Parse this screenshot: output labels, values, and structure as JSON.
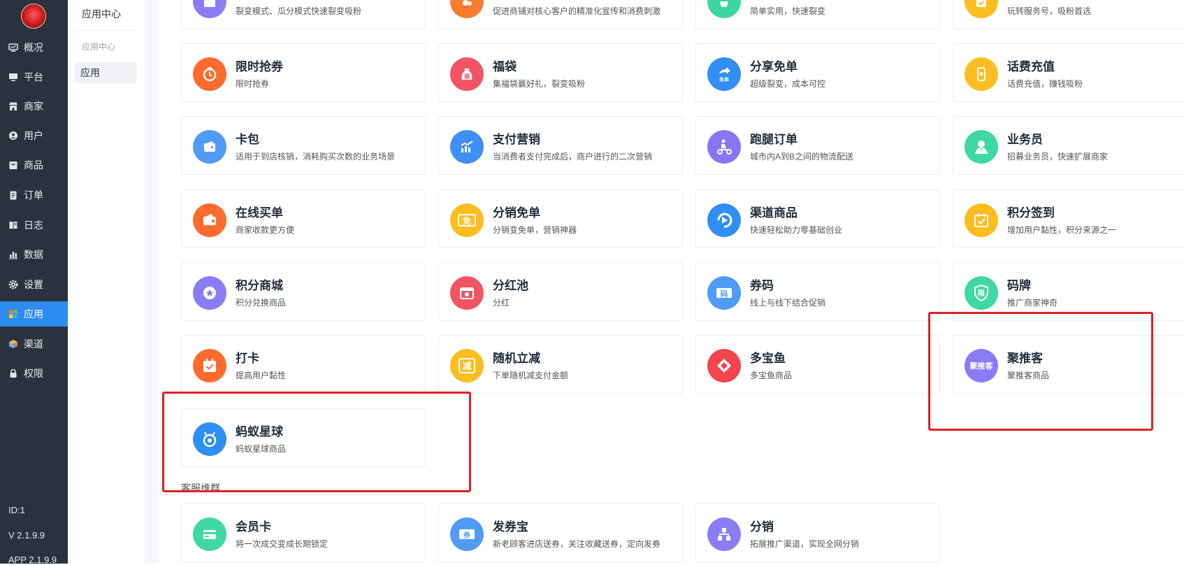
{
  "sidebar": {
    "items": [
      {
        "label": "概况",
        "icon": "chart-monitor-icon"
      },
      {
        "label": "平台",
        "icon": "monitor-icon"
      },
      {
        "label": "商家",
        "icon": "store-icon"
      },
      {
        "label": "用户",
        "icon": "user-icon"
      },
      {
        "label": "商品",
        "icon": "bag-icon"
      },
      {
        "label": "订单",
        "icon": "clipboard-icon"
      },
      {
        "label": "日志",
        "icon": "log-book-icon"
      },
      {
        "label": "数据",
        "icon": "bar-chart-icon"
      },
      {
        "label": "设置",
        "icon": "gear-icon"
      },
      {
        "label": "应用",
        "icon": "apps-grid-icon",
        "active": true
      },
      {
        "label": "渠道",
        "icon": "cube-icon"
      },
      {
        "label": "权限",
        "icon": "lock-icon"
      }
    ],
    "footer": {
      "id": "ID:1",
      "version": "V 2.1.9.9",
      "app_version": "APP 2.1.9.9"
    }
  },
  "subnav": {
    "title": "应用中心",
    "group": "应用中心",
    "item": "应用"
  },
  "section_label": "客服维群",
  "cards": [
    {
      "title": "",
      "desc": "裂变模式、瓜分模式快速裂变吸粉",
      "color": "#8b7cf6",
      "icon": "gift-icon"
    },
    {
      "title": "",
      "desc": "促进商铺对核心客户的精准化宣传和消费刺激",
      "color": "#fb7a2e",
      "icon": "user-group-icon"
    },
    {
      "title": "",
      "desc": "简单实用，快速裂变",
      "color": "#3cd6a0",
      "icon": "share-box-icon"
    },
    {
      "title": "",
      "desc": "玩转服务号，吸粉首选",
      "color": "#fbbd1f",
      "icon": "check-badge-icon"
    },
    {
      "title": "限时抢券",
      "desc": "限时抢券",
      "color": "#ff6b2e",
      "icon": "stopwatch-icon"
    },
    {
      "title": "福袋",
      "desc": "集福袋赢好礼，裂变吸粉",
      "color": "#f25463",
      "icon": "lucky-bag-icon",
      "glyph": "福"
    },
    {
      "title": "分享免单",
      "desc": "超级裂变，成本可控",
      "color": "#2f8ff5",
      "icon": "share-free-icon",
      "glyph": "免单"
    },
    {
      "title": "话费充值",
      "desc": "话费充值，赚钱吸粉",
      "color": "#fbbd1f",
      "icon": "phone-yen-icon"
    },
    {
      "title": "卡包",
      "desc": "适用于到店核销，消耗购买次数的业务场景",
      "color": "#4f9bf6",
      "icon": "card-wallet-icon"
    },
    {
      "title": "支付营销",
      "desc": "当消费者支付完成后，商户进行的二次营销",
      "color": "#3f8ef5",
      "icon": "growth-chart-icon"
    },
    {
      "title": "跑腿订单",
      "desc": "城市内A到B之间的物流配送",
      "color": "#8a74f2",
      "icon": "courier-scooter-icon"
    },
    {
      "title": "业务员",
      "desc": "招募业务员，快速扩展商家",
      "color": "#3fd8a2",
      "icon": "salesman-icon"
    },
    {
      "title": "在线买单",
      "desc": "商家收款更方便",
      "color": "#ff6b2e",
      "icon": "wallet-icon"
    },
    {
      "title": "分销免单",
      "desc": "分销变免单，营销神器",
      "color": "#fbbd1f",
      "icon": "free-ticket-icon",
      "glyph": "免"
    },
    {
      "title": "渠道商品",
      "desc": "快速轻松助力零基础创业",
      "color": "#2f8ff5",
      "icon": "play-circle-icon"
    },
    {
      "title": "积分签到",
      "desc": "增加用户黏性，积分来源之一",
      "color": "#fbbd1f",
      "icon": "calendar-check-icon"
    },
    {
      "title": "积分商城",
      "desc": "积分兑换商品",
      "color": "#8b7cf6",
      "icon": "star-badge-icon"
    },
    {
      "title": "分红池",
      "desc": "分红",
      "color": "#f25463",
      "icon": "dividend-box-icon"
    },
    {
      "title": "券码",
      "desc": "线上与线下结合促销",
      "color": "#4f9bf6",
      "icon": "coupon-code-icon",
      "glyph": "码"
    },
    {
      "title": "码牌",
      "desc": "推广商家神奇",
      "color": "#3fd8a2",
      "icon": "shield-limit-icon",
      "glyph": "限"
    },
    {
      "title": "打卡",
      "desc": "提高用户黏性",
      "color": "#ff6b2e",
      "icon": "calendar-punch-icon"
    },
    {
      "title": "随机立减",
      "desc": "下单随机减支付金额",
      "color": "#fbbd1f",
      "icon": "random-discount-icon",
      "glyph": "减"
    },
    {
      "title": "多宝鱼",
      "desc": "多宝鱼商品",
      "color": "#f2454d",
      "icon": "diamond-logo-icon"
    },
    {
      "title": "聚推客",
      "desc": "聚推客商品",
      "color": "#8b7cf6",
      "icon": "jutuike-logo-icon",
      "glyph": "聚推客"
    },
    {
      "title": "蚂蚁星球",
      "desc": "蚂蚁星球商品",
      "color": "#2f8ff5",
      "icon": "ant-planet-icon"
    },
    {
      "title": "会员卡",
      "desc": "将一次成交变成长期锁定",
      "color": "#3fd8a2",
      "icon": "member-card-icon"
    },
    {
      "title": "发券宝",
      "desc": "新老顾客进店送券，关注收藏送券，定向发券",
      "color": "#4f9bf6",
      "icon": "coupon-send-icon",
      "glyph": "券"
    },
    {
      "title": "分销",
      "desc": "拓展推广渠道，实现全网分销",
      "color": "#8b7cf6",
      "icon": "distribution-tree-icon"
    }
  ]
}
